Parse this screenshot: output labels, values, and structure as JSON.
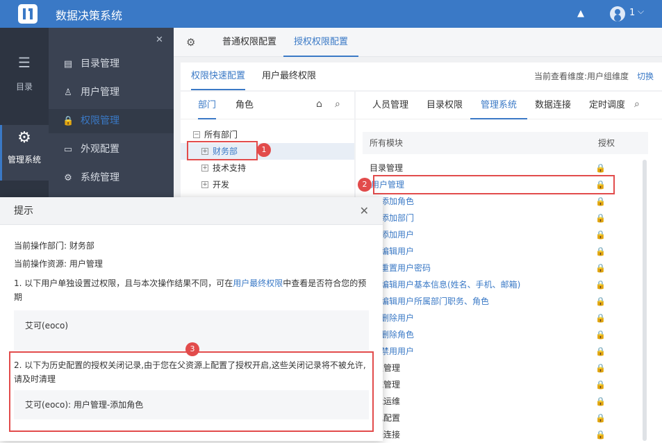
{
  "app": {
    "title": "数据决策系统",
    "user": "1"
  },
  "leftnav": [
    {
      "label": "目录",
      "icon": "list-icon"
    },
    {
      "label": "管理系统",
      "icon": "gear-icon"
    }
  ],
  "submenu": [
    {
      "label": "目录管理",
      "icon": "catalog-icon"
    },
    {
      "label": "用户管理",
      "icon": "user-icon"
    },
    {
      "label": "权限管理",
      "icon": "lock-icon"
    },
    {
      "label": "外观配置",
      "icon": "paint-roller-icon"
    },
    {
      "label": "系统管理",
      "icon": "gear-icon"
    }
  ],
  "tabs1": {
    "normal": "普通权限配置",
    "auth": "授权权限配置"
  },
  "tabs2": {
    "quick": "权限快速配置",
    "final": "用户最终权限",
    "info": "当前查看维度:用户组维度",
    "switch": "切换"
  },
  "deptabs": {
    "dept": "部门",
    "role": "角色"
  },
  "tree": [
    "所有部门",
    "财务部",
    "技术支持",
    "开发"
  ],
  "modtabs": [
    "人员管理",
    "目录权限",
    "管理系统",
    "数据连接",
    "定时调度"
  ],
  "modhead": {
    "col1": "所有模块",
    "col2": "授权"
  },
  "modules": [
    "目录管理",
    "用户管理",
    "添加角色",
    "添加部门",
    "添加用户",
    "编辑用户",
    "重置用户密码",
    "编辑用户基本信息(姓名、手机、邮箱)",
    "编辑用户所属部门职务、角色",
    "删除用户",
    "删除角色",
    "禁用用户",
    "权限管理",
    "系统管理",
    "智能运维",
    "外观配置",
    "数据连接"
  ],
  "badges": [
    "1",
    "2",
    "3"
  ],
  "dialog": {
    "title": "提示",
    "dept": "当前操作部门: 财务部",
    "res": "当前操作资源: 用户管理",
    "p1a": "1. 以下用户单独设置过权限，且与本次操作结果不同，可在",
    "p1link": "用户最终权限",
    "p1b": "中查看是否符合您的预期",
    "user1": "艾可(eoco)",
    "p2": "2. 以下为历史配置的授权关闭记录,由于您在父资源上配置了授权开启,这些关闭记录将不被允许,请及时清理",
    "user2": "艾可(eoco): 用户管理-添加角色"
  }
}
